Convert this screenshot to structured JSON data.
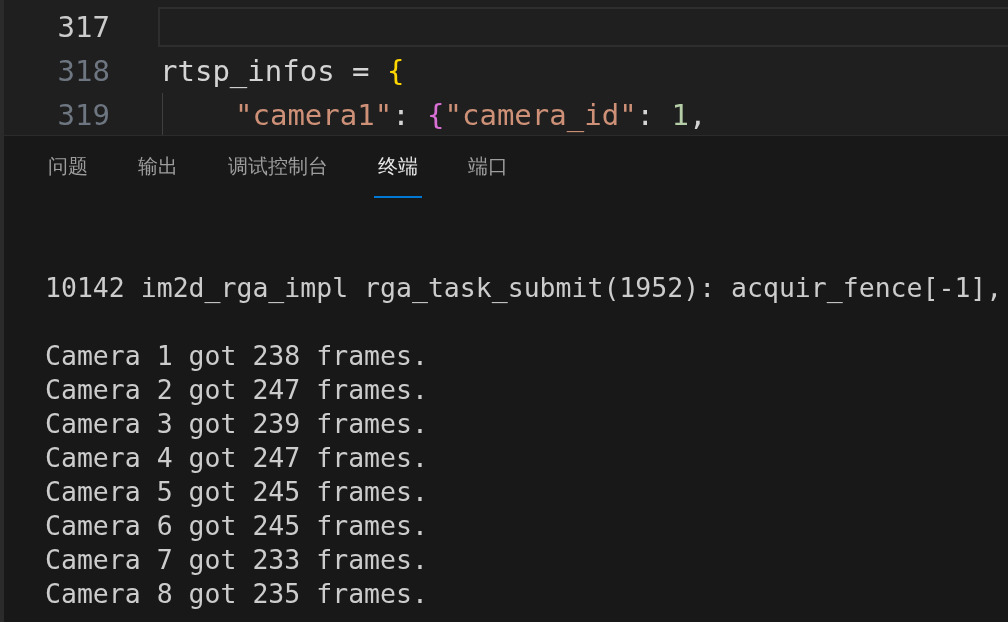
{
  "editor": {
    "lines": [
      {
        "number": "317",
        "active": true,
        "indented": false
      },
      {
        "number": "318",
        "active": false,
        "indented": false,
        "tokens": [
          {
            "kind": "text",
            "text": "rtsp_infos = "
          },
          {
            "kind": "brace",
            "text": "{"
          }
        ]
      },
      {
        "number": "319",
        "active": false,
        "indented": true,
        "tokens": [
          {
            "kind": "string",
            "text": "\"camera1\""
          },
          {
            "kind": "text",
            "text": ": "
          },
          {
            "kind": "brace2",
            "text": "{"
          },
          {
            "kind": "string",
            "text": "\"camera_id\""
          },
          {
            "kind": "text",
            "text": ": "
          },
          {
            "kind": "number",
            "text": "1"
          },
          {
            "kind": "text",
            "text": ","
          }
        ]
      }
    ]
  },
  "panel": {
    "tabs": [
      {
        "label": "问题",
        "selected": false
      },
      {
        "label": "输出",
        "selected": false
      },
      {
        "label": "调试控制台",
        "selected": false
      },
      {
        "label": "终端",
        "selected": true
      },
      {
        "label": "端口",
        "selected": false
      }
    ],
    "terminal_groups": [
      [
        "10142 im2d_rga_impl rga_task_submit(1952): acquir_fence[-1],"
      ],
      [
        "Camera 1 got 238 frames.",
        "Camera 2 got 247 frames.",
        "Camera 3 got 239 frames.",
        "Camera 4 got 247 frames.",
        "Camera 5 got 245 frames.",
        "Camera 6 got 245 frames.",
        "Camera 7 got 233 frames.",
        "Camera 8 got 235 frames."
      ]
    ]
  }
}
